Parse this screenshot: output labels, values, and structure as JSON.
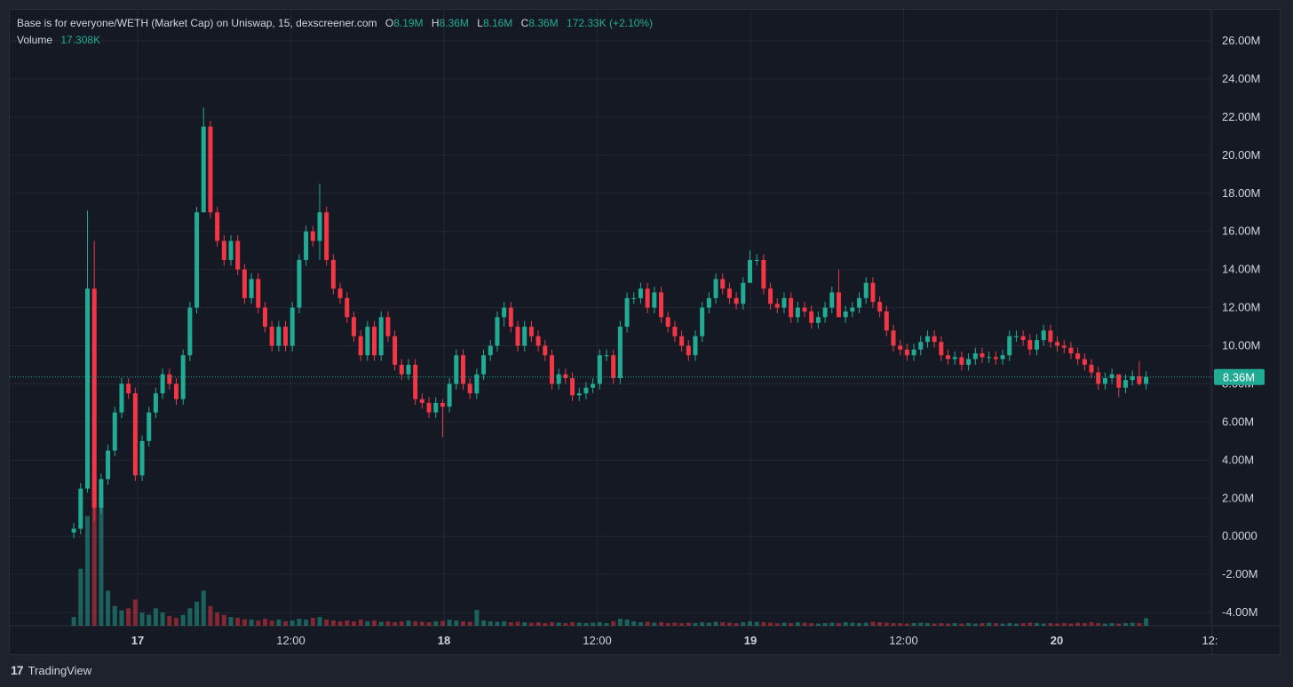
{
  "legend": {
    "title": "Base is for everyone/WETH (Market Cap) on Uniswap, 15, dexscreener.com",
    "o_label": "O",
    "o_value": "8.19M",
    "h_label": "H",
    "h_value": "8.36M",
    "l_label": "L",
    "l_value": "8.16M",
    "c_label": "C",
    "c_value": "8.36M",
    "change": "172.33K (+2.10%)",
    "volume_label": "Volume",
    "volume_value": "17.308K"
  },
  "footer": {
    "logo": "17",
    "brand": "TradingView"
  },
  "colors": {
    "up": "#22ab94",
    "down": "#f23645",
    "background": "#151924",
    "grid": "#232733",
    "text": "#d1d4dc"
  },
  "chart_data": {
    "type": "candlestick",
    "title": "Base is for everyone/WETH (Market Cap)",
    "interval": "15",
    "ylabel": "Market Cap",
    "ylim": [
      -4.8,
      27
    ],
    "y_ticks": [
      26,
      24,
      22,
      20,
      18,
      16,
      14,
      12,
      10,
      8,
      6,
      4,
      2,
      0,
      -2,
      -4
    ],
    "y_tick_labels": [
      "26.00M",
      "24.00M",
      "22.00M",
      "20.00M",
      "18.00M",
      "16.00M",
      "14.00M",
      "12.00M",
      "10.00M",
      "8.00M",
      "6.00M",
      "4.00M",
      "2.00M",
      "0.0000",
      "-2.00M",
      "-4.00M"
    ],
    "x_ticks_hours": [
      0,
      12,
      24,
      36,
      48,
      60,
      72,
      84
    ],
    "x_tick_labels": [
      "17",
      "12:00",
      "18",
      "12:00",
      "19",
      "12:00",
      "20",
      "12:"
    ],
    "x_tick_bold": [
      true,
      false,
      true,
      false,
      true,
      false,
      true,
      false
    ],
    "start_hour": -5,
    "interval_hours": 0.535,
    "last_price": 8.36,
    "last_price_label": "8.36M",
    "default_wick": 0.3,
    "close": [
      0.4,
      2.5,
      13,
      1.5,
      3,
      4.5,
      6.5,
      8,
      7.5,
      3.2,
      5,
      6.5,
      7.5,
      8.5,
      8,
      7.2,
      9.5,
      12,
      17,
      21.5,
      17,
      15.5,
      14.5,
      15.5,
      14,
      12.5,
      13.5,
      12,
      11,
      10,
      11,
      10,
      12,
      14.5,
      16,
      15.5,
      17,
      14.5,
      13,
      12.5,
      11.5,
      10.5,
      9.5,
      11,
      9.5,
      11.5,
      10.5,
      9,
      8.5,
      9,
      7.2,
      7,
      6.5,
      7,
      6.8,
      8,
      9.5,
      8,
      7.5,
      8.5,
      9.5,
      10,
      11.5,
      12,
      11,
      10,
      11,
      10.5,
      10,
      9.5,
      8,
      8.5,
      8.3,
      7.4,
      7.5,
      7.8,
      8,
      9.5,
      9.5,
      8.3,
      11,
      12.5,
      12.5,
      13,
      12,
      12.8,
      11.5,
      11,
      10.5,
      10,
      9.5,
      10.5,
      12,
      12.5,
      13.5,
      13,
      12.5,
      12.2,
      13.3,
      14.5,
      14.5,
      13,
      12.2,
      12,
      12.5,
      11.5,
      12,
      11.8,
      11.2,
      11.5,
      12,
      12.8,
      11.5,
      11.8,
      12,
      12.5,
      13.3,
      12.3,
      11.8,
      10.8,
      10,
      9.8,
      9.5,
      9.8,
      10.2,
      10.5,
      10.2,
      9.5,
      9.3,
      9.4,
      9,
      9.3,
      9.6,
      9.4,
      9.4,
      9.3,
      9.5,
      10.5,
      10.5,
      10.3,
      9.8,
      10.3,
      10.8,
      10.2,
      10,
      9.9,
      9.6,
      9.3,
      9,
      8.6,
      8,
      8.3,
      8.5,
      7.8,
      8.2,
      8.4,
      8,
      8.36
    ],
    "first_open": 0.2,
    "notable_wicks": {
      "2": [
        17.1,
        2.3
      ],
      "3": [
        15.5,
        0.8
      ],
      "9": [
        7.8,
        2.9
      ],
      "19": [
        22.5,
        17
      ],
      "36": [
        18.5,
        14.5
      ],
      "54": [
        7.2,
        5.2
      ],
      "63": [
        12.3,
        11
      ],
      "99": [
        15,
        13.3
      ],
      "112": [
        14,
        11.5
      ],
      "153": [
        8.5,
        7.3
      ],
      "156": [
        9.2,
        7.9
      ]
    },
    "volume": [
      20,
      130,
      250,
      350,
      300,
      80,
      45,
      35,
      40,
      60,
      30,
      25,
      40,
      30,
      22,
      18,
      25,
      40,
      55,
      80,
      45,
      30,
      25,
      20,
      18,
      15,
      14,
      12,
      16,
      12,
      14,
      10,
      12,
      16,
      14,
      18,
      20,
      14,
      12,
      10,
      12,
      10,
      14,
      10,
      12,
      9,
      10,
      8,
      10,
      12,
      10,
      9,
      8,
      10,
      11,
      14,
      12,
      10,
      9,
      36,
      12,
      10,
      9,
      10,
      8,
      9,
      8,
      7,
      8,
      6,
      8,
      7,
      6,
      8,
      7,
      6,
      7,
      8,
      6,
      10,
      16,
      14,
      10,
      8,
      9,
      7,
      8,
      6,
      7,
      6,
      7,
      6,
      8,
      7,
      9,
      8,
      7,
      6,
      8,
      10,
      9,
      8,
      7,
      6,
      7,
      6,
      8,
      7,
      6,
      5,
      6,
      7,
      6,
      8,
      7,
      6,
      7,
      9,
      8,
      7,
      6,
      6,
      5,
      6,
      7,
      6,
      5,
      6,
      5,
      6,
      5,
      6,
      5,
      6,
      7,
      6,
      5,
      6,
      5,
      6,
      7,
      6,
      5,
      6,
      5,
      6,
      5,
      7,
      6,
      8,
      6,
      5,
      6,
      5,
      6,
      7,
      6,
      17.308
    ]
  }
}
